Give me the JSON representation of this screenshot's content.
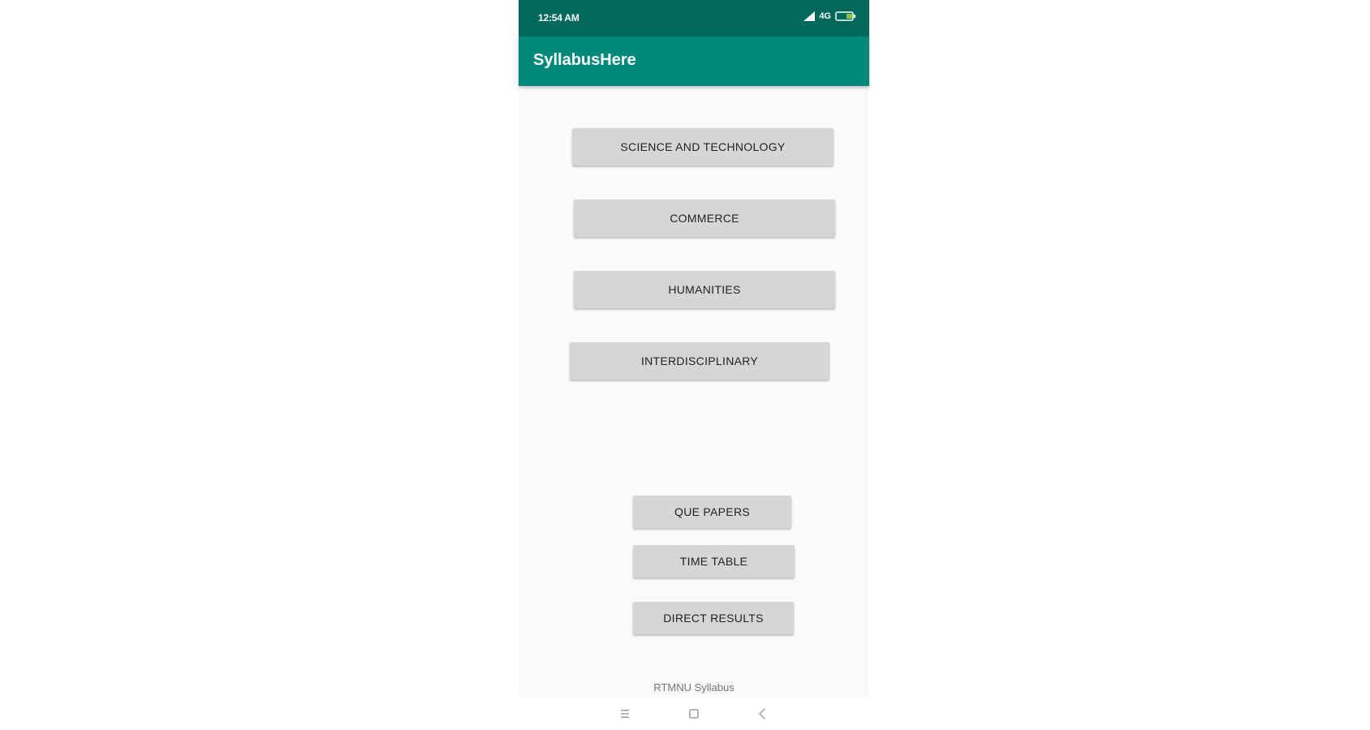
{
  "status_bar": {
    "time": "12:54 AM",
    "network": "4G",
    "icons": [
      "signal-icon",
      "battery-icon"
    ]
  },
  "app_bar": {
    "title": "SyllabusHere"
  },
  "buttons": {
    "science_and_technology": "SCIENCE AND TECHNOLOGY",
    "commerce": "COMMERCE",
    "humanities": "HUMANITIES",
    "interdisciplinary": "INTERDISCIPLINARY",
    "que_papers": "QUE PAPERS",
    "time_table": "TIME TABLE",
    "direct_results": "DIRECT RESULTS"
  },
  "footer": {
    "label": "RTMNU Syllabus"
  },
  "nav_bar": {
    "icons": [
      "menu-icon",
      "home-square-icon",
      "back-icon"
    ]
  },
  "colors": {
    "status_bar": "#00695c",
    "app_bar": "#00897b",
    "button": "#d6d6d6",
    "background": "#fafafa"
  }
}
